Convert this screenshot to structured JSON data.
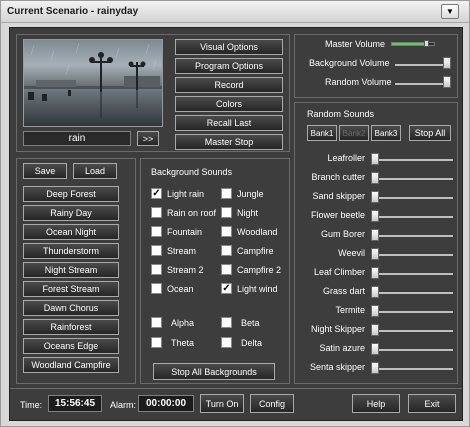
{
  "window": {
    "title": "Current Scenario - rainyday",
    "menu_arrow": "▼"
  },
  "preview": {
    "caption": "rain",
    "next_label": ">>"
  },
  "menu_buttons": [
    "Visual Options",
    "Program Options",
    "Record",
    "Colors",
    "Recall Last",
    "Master Stop"
  ],
  "volume": {
    "master_label": "Master Volume",
    "background_label": "Background Volume",
    "random_label": "Random Volume",
    "master_level": 0.75,
    "master_color": "#5ad05a"
  },
  "scenarios": {
    "save_label": "Save",
    "load_label": "Load",
    "items": [
      "Deep Forest",
      "Rainy Day",
      "Ocean Night",
      "Thunderstorm",
      "Night Stream",
      "Forest Stream",
      "Dawn Chorus",
      "Rainforest",
      "Oceans Edge",
      "Woodland Campfire"
    ]
  },
  "background_sounds": {
    "heading": "Background Sounds",
    "left": [
      {
        "label": "Light rain",
        "checked": true
      },
      {
        "label": "Rain on roof",
        "checked": false
      },
      {
        "label": "Fountain",
        "checked": false
      },
      {
        "label": "Stream",
        "checked": false
      },
      {
        "label": "Stream 2",
        "checked": false
      },
      {
        "label": "Ocean",
        "checked": false
      }
    ],
    "right": [
      {
        "label": "Jungle",
        "checked": false
      },
      {
        "label": "Night",
        "checked": false
      },
      {
        "label": "Woodland",
        "checked": false
      },
      {
        "label": "Campfire",
        "checked": false
      },
      {
        "label": "Campfire 2",
        "checked": false
      },
      {
        "label": "Light wind",
        "checked": true
      }
    ],
    "waves_left": [
      {
        "label": "Alpha",
        "checked": false
      },
      {
        "label": "Theta",
        "checked": false
      }
    ],
    "waves_right": [
      {
        "label": "Beta",
        "checked": false
      },
      {
        "label": "Delta",
        "checked": false
      }
    ],
    "stop_all_label": "Stop All Backgrounds"
  },
  "random_sounds": {
    "heading": "Random Sounds",
    "banks": [
      "Bank1",
      "Bank2",
      "Bank3"
    ],
    "stop_all_label": "Stop All",
    "items": [
      "Leafroller",
      "Branch cutter",
      "Sand skipper",
      "Flower beetle",
      "Gum Borer",
      "Weevil",
      "Leaf Climber",
      "Grass dart",
      "Termite",
      "Night Skipper",
      "Satin azure",
      "Senta skipper"
    ]
  },
  "footer": {
    "time_label": "Time:",
    "time_value": "15:56:45",
    "alarm_label": "Alarm:",
    "alarm_value": "00:00:00",
    "turn_on_label": "Turn On",
    "config_label": "Config",
    "help_label": "Help",
    "exit_label": "Exit"
  }
}
